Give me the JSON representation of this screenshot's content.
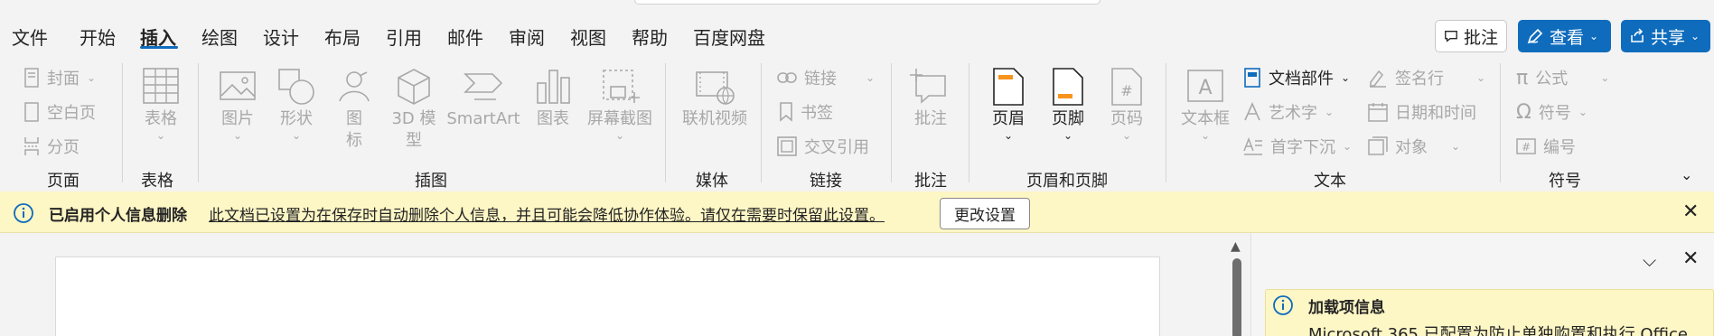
{
  "tabs": [
    {
      "label": "文件",
      "active": false
    },
    {
      "label": "开始",
      "active": false
    },
    {
      "label": "插入",
      "active": true
    },
    {
      "label": "绘图",
      "active": false
    },
    {
      "label": "设计",
      "active": false
    },
    {
      "label": "布局",
      "active": false
    },
    {
      "label": "引用",
      "active": false
    },
    {
      "label": "邮件",
      "active": false
    },
    {
      "label": "审阅",
      "active": false
    },
    {
      "label": "视图",
      "active": false
    },
    {
      "label": "帮助",
      "active": false
    },
    {
      "label": "百度网盘",
      "active": false
    }
  ],
  "header_buttons": {
    "comment": "批注",
    "view": "查看",
    "share": "共享"
  },
  "ribbon": {
    "pages": {
      "label": "页面",
      "cover": "封面",
      "blank": "空白页",
      "break": "分页"
    },
    "tables": {
      "label": "表格",
      "table": "表格"
    },
    "illustrations": {
      "label": "插图",
      "picture": "图片",
      "shapes": "形状",
      "icons_1": "图",
      "icons_2": "标",
      "model_1": "3D 模",
      "model_2": "型",
      "smartart": "SmartArt",
      "chart": "图表",
      "screenshot": "屏幕截图"
    },
    "media": {
      "label": "媒体",
      "online_video": "联机视频"
    },
    "links": {
      "label": "链接",
      "link": "链接",
      "bookmark": "书签",
      "cross_ref": "交叉引用"
    },
    "comments": {
      "label": "批注",
      "comment": "批注"
    },
    "header_footer": {
      "label": "页眉和页脚",
      "header": "页眉",
      "footer": "页脚",
      "page_number": "页码"
    },
    "text": {
      "label": "文本",
      "textbox": "文本框",
      "quick_parts": "文档部件",
      "wordart": "艺术字",
      "dropcap": "首字下沉",
      "signature": "签名行",
      "datetime": "日期和时间",
      "object": "对象"
    },
    "symbols": {
      "label": "符号",
      "equation": "公式",
      "symbol": "符号",
      "number": "编号"
    }
  },
  "infobar": {
    "title": "已启用个人信息删除",
    "message": "此文档已设置为在保存时自动删除个人信息，并且可能会降低协作体验。请仅在需要时保留此设置。",
    "button": "更改设置"
  },
  "addin_panel": {
    "title": "加载项信息",
    "text": "Microsoft 365 已配置为防止单独购置和执行 Office"
  },
  "colors": {
    "accent": "#0f6cbd",
    "infobar": "#fdf6c5",
    "disabled": "#a8a8a8"
  }
}
